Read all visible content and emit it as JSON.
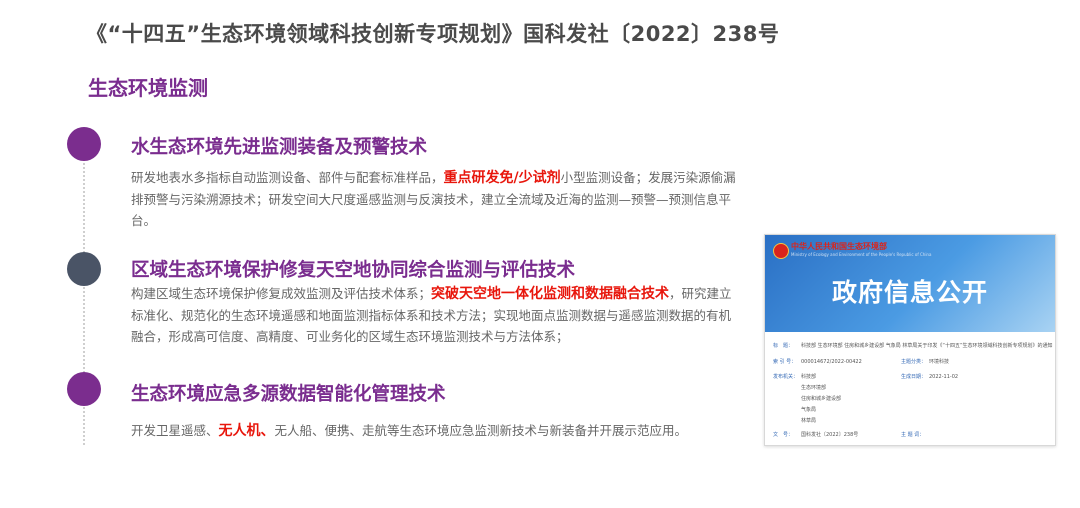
{
  "header": {
    "title": "《“十四五”生态环境领域科技创新专项规划》国科发社〔2022〕238号"
  },
  "section": {
    "title": "生态环境监测"
  },
  "items": [
    {
      "heading": "水生态环境先进监测装备及预警技术",
      "text_before": "研发地表水多指标自动监测设备、部件与配套标准样品，",
      "highlight": "重点研发免/少试剂",
      "text_after": "小型监测设备；发展污染源偷漏排预警与污染溯源技术；研发空间大尺度遥感监测与反演技术，建立全流域及近海的监测—预警—预测信息平台。"
    },
    {
      "heading": "区域生态环境保护修复天空地协同综合监测与评估技术",
      "text_before": "构建区域生态环境保护修复成效监测及评估技术体系；",
      "highlight": "突破天空地一体化监测和数据融合技术",
      "text_after": "，研究建立标准化、规范化的生态环境遥感和地面监测指标体系和技术方法；实现地面点监测数据与遥感监测数据的有机融合，形成高可信度、高精度、可业务化的区域生态环境监测技术与方法体系；"
    },
    {
      "heading": "生态环境应急多源数据智能化管理技术",
      "text_before": "开发卫星遥感、",
      "highlight": "无人机、",
      "text_after": "无人船、便携、走航等生态环境应急监测新技术与新装备并开展示范应用。"
    }
  ],
  "card": {
    "ministry": "中华人民共和国生态环境部",
    "ministry_en": "Ministry of Ecology and Environment of the People's Republic of China",
    "banner": "政府信息公开",
    "rows": [
      {
        "k": "标　题：",
        "v": "科技部 生态环境部 住房和城乡建设部 气象局 林草局关于印发《“十四五”生态环境领域科技创新专项规划》的通知"
      },
      {
        "k": "索 引 号：",
        "v": "000014672/2022-00422",
        "k2": "主题分类：",
        "v2": "环境科技"
      },
      {
        "k": "发布机关：",
        "v": "科技部",
        "k2": "生成日期：",
        "v2": "2022-11-02"
      },
      {
        "k": "",
        "v": "生态环境部"
      },
      {
        "k": "",
        "v": "住房和城乡建设部"
      },
      {
        "k": "",
        "v": "气象局"
      },
      {
        "k": "",
        "v": "林草局"
      },
      {
        "k": "文　号：",
        "v": "国科发社〔2022〕238号",
        "k2": "主 题 词：",
        "v2": ""
      }
    ]
  }
}
